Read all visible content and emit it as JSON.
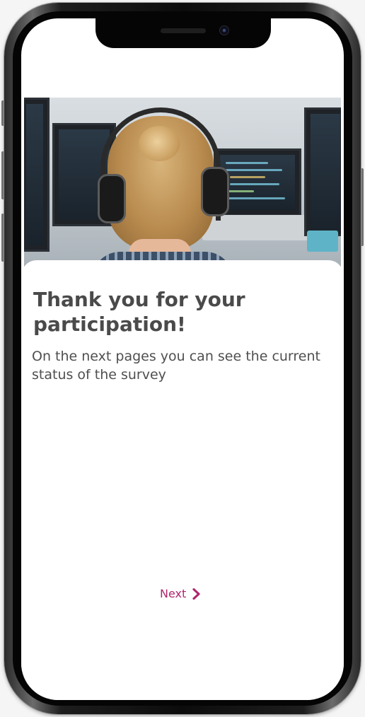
{
  "screen": {
    "title": "Thank you for your participation!",
    "subtitle": "On the next pages you can see the current status of the survey",
    "next_label": "Next"
  },
  "hero_image": {
    "description_icon": "person-with-headphones-at-computer-image"
  },
  "colors": {
    "accent": "#b0266d",
    "title_text": "#4a4a4a",
    "body_text": "#4f4f4f",
    "background": "#ffffff"
  }
}
